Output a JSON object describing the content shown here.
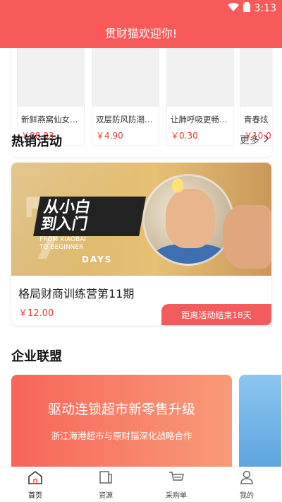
{
  "status_bar": {
    "time": "3:13"
  },
  "header": {
    "title": "贯财猫欢迎你!"
  },
  "products": [
    {
      "name": "新鲜燕窝仙女…",
      "price": "￥88.83"
    },
    {
      "name": "双层防风防潮…",
      "price": "￥4.90"
    },
    {
      "name": "让肺呼吸更畅…",
      "price": "￥0.30"
    },
    {
      "name": "青春炫",
      "price": "￥10.0"
    }
  ],
  "hot": {
    "title": "热销活动",
    "more": "更多",
    "banner": {
      "slogan_line1": "从小白",
      "slogan_line2": "到入门",
      "sub_line1": "FROM XIAOBAI",
      "sub_line2": "TO BEGINNER",
      "days": "DAYS"
    },
    "activity_name": "格局财商训练营第11期",
    "activity_price": "￥12.00",
    "countdown": "距离活动结束18天"
  },
  "alliance": {
    "title": "企业联盟",
    "headline": "驱动连锁超市新零售升级",
    "subline": "浙江海港超市与原财猫深化战略合作"
  },
  "tabs": [
    {
      "label": "首页",
      "icon": "home-icon"
    },
    {
      "label": "资源",
      "icon": "resource-icon"
    },
    {
      "label": "采购单",
      "icon": "cart-icon"
    },
    {
      "label": "我的",
      "icon": "profile-icon"
    }
  ],
  "colors": {
    "brand": "#f85a5a",
    "price": "#e53935"
  }
}
